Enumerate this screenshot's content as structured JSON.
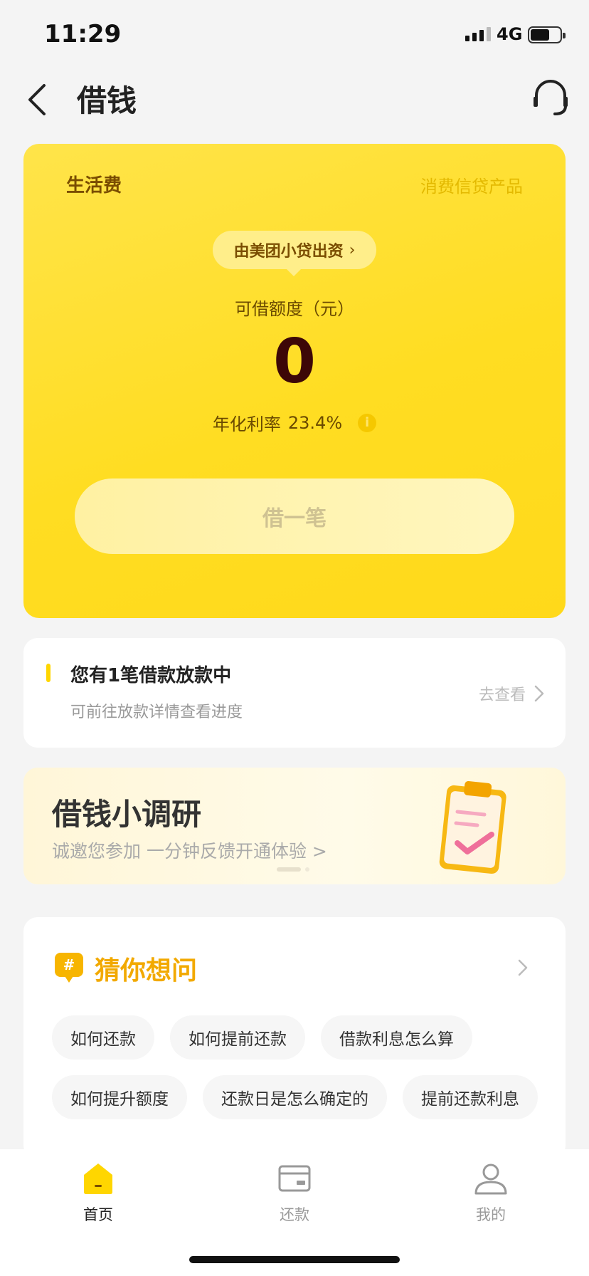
{
  "status_bar": {
    "time": "11:29",
    "network": "4G"
  },
  "nav": {
    "title": "借钱"
  },
  "loan_card": {
    "product_name": "生活费",
    "product_type": "消费信贷产品",
    "lender": "由美团小贷出资",
    "limit_label": "可借额度（元）",
    "limit_value": "0",
    "rate_label": "年化利率",
    "rate_value": "23.4%",
    "info_glyph": "i",
    "borrow_label": "借一笔"
  },
  "notice": {
    "title": "您有1笔借款放款中",
    "subtitle": "可前往放款详情查看进度",
    "link": "去查看"
  },
  "survey": {
    "title": "借钱小调研",
    "subtitle": "诚邀您参加   一分钟反馈开通体验 >",
    "active_page": 1,
    "page_count": 2
  },
  "faq": {
    "title": "猜你想问",
    "icon_glyph": "#",
    "row1": [
      "如何还款",
      "如何提前还款",
      "借款利息怎么算"
    ],
    "row2": [
      "如何提升额度",
      "还款日是怎么确定的",
      "提前还款利息"
    ]
  },
  "tabs": [
    {
      "label": "首页",
      "icon": "home-icon",
      "active": true
    },
    {
      "label": "还款",
      "icon": "card-icon",
      "active": false
    },
    {
      "label": "我的",
      "icon": "user-icon",
      "active": false
    }
  ],
  "colors": {
    "accent_yellow": "#ffd600",
    "card_yellow": "#ffdd22",
    "faq_title": "#f2a900",
    "tab_active": "#222222",
    "tab_inactive": "#999999"
  }
}
